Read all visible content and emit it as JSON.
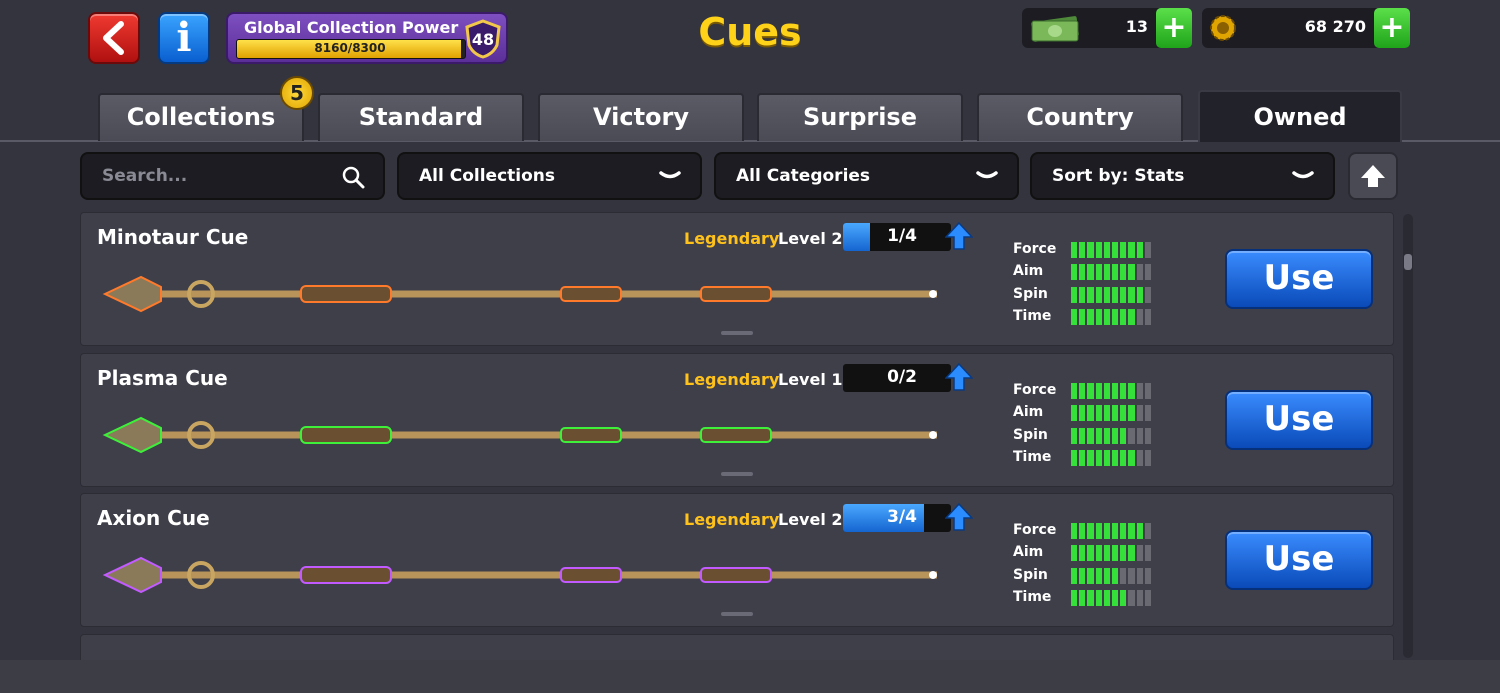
{
  "header": {
    "title": "Cues",
    "back_icon": "back-arrow-icon",
    "info_icon": "info-icon",
    "collection_power": {
      "label": "Global Collection Power",
      "progress_text": "8160/8300",
      "progress": 0.983,
      "level": "48"
    },
    "cash": {
      "icon": "cash-icon",
      "value": "13"
    },
    "coins": {
      "icon": "coin-icon",
      "value": "68 270"
    }
  },
  "tabs": [
    {
      "label": "Collections",
      "badge": "5"
    },
    {
      "label": "Standard"
    },
    {
      "label": "Victory"
    },
    {
      "label": "Surprise"
    },
    {
      "label": "Country"
    },
    {
      "label": "Owned",
      "active": true
    }
  ],
  "filters": {
    "search_placeholder": "Search...",
    "collection": "All Collections",
    "category": "All Categories",
    "sort": "Sort by: Stats"
  },
  "stat_labels": [
    "Force",
    "Aim",
    "Spin",
    "Time"
  ],
  "cues": [
    {
      "name": "Minotaur Cue",
      "rarity": "Legendary",
      "level": "Level 2",
      "progress_text": "1/4",
      "progress": 0.25,
      "use_label": "Use",
      "stats": [
        9,
        8,
        9,
        8
      ],
      "accent": "#ff7a2a"
    },
    {
      "name": "Plasma Cue",
      "rarity": "Legendary",
      "level": "Level 1",
      "progress_text": "0/2",
      "progress": 0,
      "use_label": "Use",
      "stats": [
        8,
        8,
        7,
        8
      ],
      "accent": "#3ef03a"
    },
    {
      "name": "Axion Cue",
      "rarity": "Legendary",
      "level": "Level 2",
      "progress_text": "3/4",
      "progress": 0.75,
      "use_label": "Use",
      "stats": [
        9,
        8,
        6,
        7
      ],
      "accent": "#c25bff"
    }
  ],
  "colors": {
    "accent_gold": "#ffd21a",
    "button_blue": "#1a6ae0",
    "stat_green": "#36e03a"
  }
}
